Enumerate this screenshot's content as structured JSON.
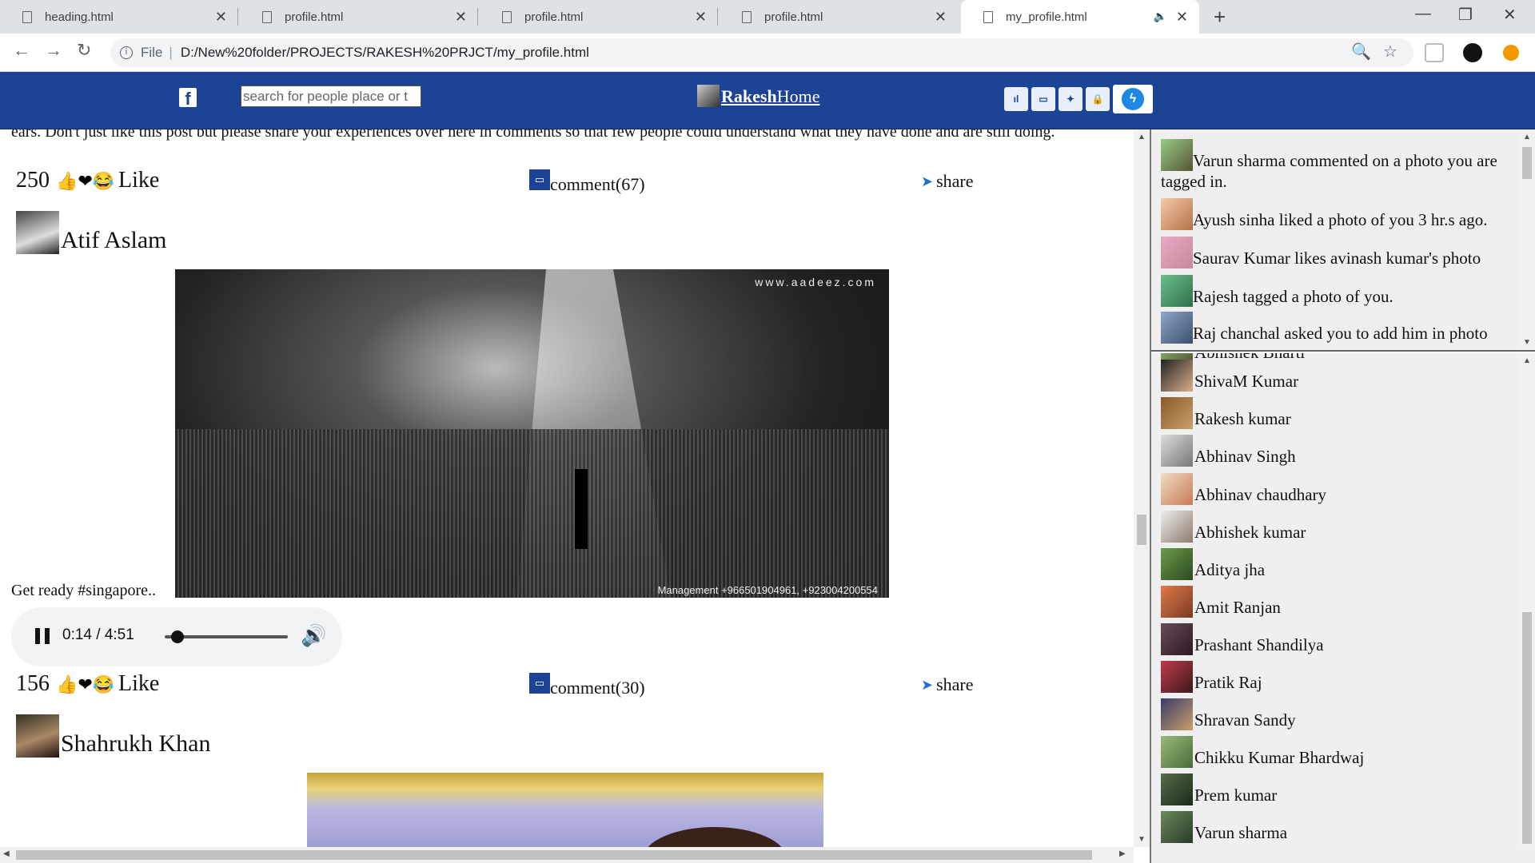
{
  "browser": {
    "tabs": [
      {
        "title": "heading.html"
      },
      {
        "title": "profile.html"
      },
      {
        "title": "profile.html"
      },
      {
        "title": "profile.html"
      },
      {
        "title": "my_profile.html"
      }
    ],
    "url_scheme": "File",
    "url": "D:/New%20folder/PROJECTS/RAKESH%20PRJCT/my_profile.html"
  },
  "header": {
    "search_placeholder": "search for people place or t",
    "home_name": "Rakesh",
    "home_label": "Home",
    "icons": [
      "friend-requests-icon",
      "messages-icon",
      "notifications-icon",
      "lock-icon",
      "messenger-icon"
    ]
  },
  "feed": {
    "intro_text": "ears. Don't just like this post but please share your experiences over here in comments so that few people could understand what they have done and are still doing.",
    "like_label": "Like",
    "share_label": "share",
    "posts": [
      {
        "likes": "250",
        "comments": "comment(67)",
        "author": "Atif Aslam",
        "image_watermark": "www.aadeez.com",
        "image_credit": "Management +966501904961, +923004200554",
        "caption": "Get ready #singapore..",
        "audio": {
          "time": "0:14 / 4:51",
          "progress": 0.05
        }
      },
      {
        "likes": "156",
        "comments": "comment(30)",
        "author": "Shahrukh Khan"
      }
    ]
  },
  "notifications": [
    "Varun sharma commented on a photo you are tagged in.",
    "Ayush sinha liked a photo of you 3 hr.s ago.",
    "Saurav Kumar likes avinash kumar's photo",
    "Rajesh tagged a photo of you.",
    "Raj chanchal asked you to add him in photo"
  ],
  "contacts": [
    "Abhishek Bharti",
    "ShivaM Kumar",
    "Rakesh kumar",
    "Abhinav Singh",
    "Abhinav chaudhary",
    "Abhishek kumar",
    "Aditya jha",
    "Amit Ranjan",
    "Prashant Shandilya",
    "Pratik Raj",
    "Shravan Sandy",
    "Chikku Kumar Bhardwaj",
    "Prem kumar",
    "Varun sharma"
  ]
}
